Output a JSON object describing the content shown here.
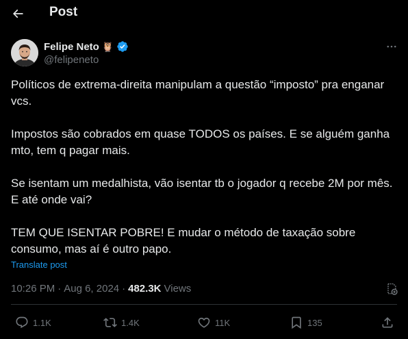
{
  "header": {
    "title": "Post",
    "back_icon": "arrow-left-icon"
  },
  "author": {
    "name": "Felipe Neto",
    "handle": "@felipeneto",
    "emoji": "🦉",
    "verified": true,
    "verified_color": "#1d9bf0"
  },
  "tweet": {
    "paragraphs": [
      "Políticos de extrema-direita manipulam a questão “imposto” pra enganar vcs.",
      "Impostos são cobrados em quase TODOS os países. E se alguém ganha mto, tem q pagar mais.",
      "Se isentam um medalhista, vão isentar tb o jogador q recebe 2M por mês. E até onde vai?",
      "TEM QUE ISENTAR POBRE! E mudar o método de taxação sobre consumo, mas aí é outro papo."
    ],
    "translate_label": "Translate post"
  },
  "meta": {
    "time": "10:26 PM",
    "separator": "·",
    "date": "Aug 6, 2024",
    "views_count": "482.3K",
    "views_label": "Views"
  },
  "actions": {
    "replies": "1.1K",
    "reposts": "1.4K",
    "likes": "11K",
    "bookmarks": "135"
  },
  "colors": {
    "background": "#000000",
    "text": "#e7e9ea",
    "muted": "#71767b",
    "accent": "#1d9bf0",
    "divider": "#2f3336"
  }
}
